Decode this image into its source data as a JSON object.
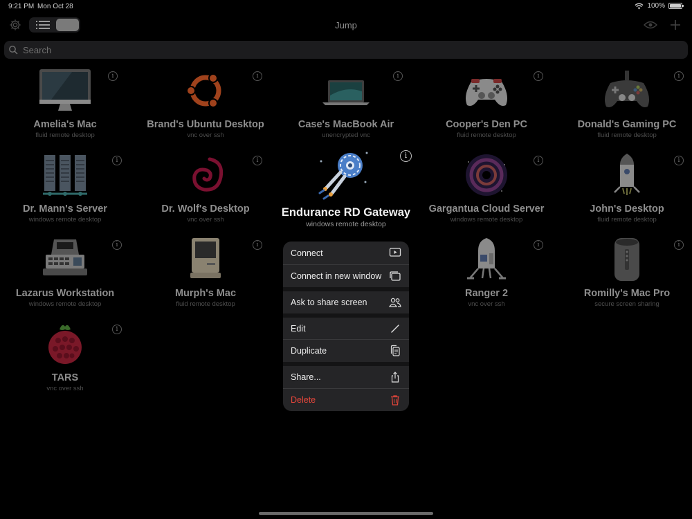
{
  "status": {
    "time": "9:21 PM",
    "date": "Mon Oct 28",
    "battery": "100%"
  },
  "nav": {
    "title": "Jump"
  },
  "search": {
    "placeholder": "Search"
  },
  "connections": [
    {
      "name": "Amelia's Mac",
      "type": "fluid remote desktop",
      "icon": "imac-icon"
    },
    {
      "name": "Brand's Ubuntu Desktop",
      "type": "vnc over ssh",
      "icon": "ubuntu-logo-icon"
    },
    {
      "name": "Case's MacBook Air",
      "type": "unencrypted vnc",
      "icon": "macbook-icon"
    },
    {
      "name": "Cooper's Den PC",
      "type": "fluid remote desktop",
      "icon": "gamepad-white-icon"
    },
    {
      "name": "Donald's Gaming PC",
      "type": "fluid remote desktop",
      "icon": "gamepad-dark-icon"
    },
    {
      "name": "Dr. Mann's Server",
      "type": "windows remote desktop",
      "icon": "server-rack-icon"
    },
    {
      "name": "Dr. Wolf's  Desktop",
      "type": "vnc over ssh",
      "icon": "debian-swirl-icon"
    },
    {
      "name": "Endurance RD Gateway",
      "type": "windows remote desktop",
      "icon": "spaceship-icon"
    },
    {
      "name": "Gargantua Cloud Server",
      "type": "windows remote desktop",
      "icon": "black-hole-icon"
    },
    {
      "name": "John's Desktop",
      "type": "fluid remote desktop",
      "icon": "rocket-capsule-icon"
    },
    {
      "name": "Lazarus Workstation",
      "type": "windows remote desktop",
      "icon": "terminal-workstation-icon"
    },
    {
      "name": "Murph's Mac",
      "type": "fluid remote desktop",
      "icon": "vintage-mac-icon"
    },
    {
      "name": "Ranger 2",
      "type": "vnc over ssh",
      "icon": "lander-icon"
    },
    {
      "name": "Romilly's Mac Pro",
      "type": "secure screen sharing",
      "icon": "mac-pro-icon"
    },
    {
      "name": "TARS",
      "type": "vnc over ssh",
      "icon": "raspberry-pi-icon"
    }
  ],
  "context_menu": {
    "items": [
      {
        "label": "Connect",
        "icon": "play-screen-icon"
      },
      {
        "label": "Connect in new window",
        "icon": "windows-stack-icon"
      },
      {
        "label": "Ask to share screen",
        "icon": "people-icon"
      },
      {
        "label": "Edit",
        "icon": "pencil-icon"
      },
      {
        "label": "Duplicate",
        "icon": "duplicate-icon"
      },
      {
        "label": "Share...",
        "icon": "share-icon"
      },
      {
        "label": "Delete",
        "icon": "trash-icon"
      }
    ],
    "danger_color": "#e5463b"
  },
  "info_glyph": "i"
}
